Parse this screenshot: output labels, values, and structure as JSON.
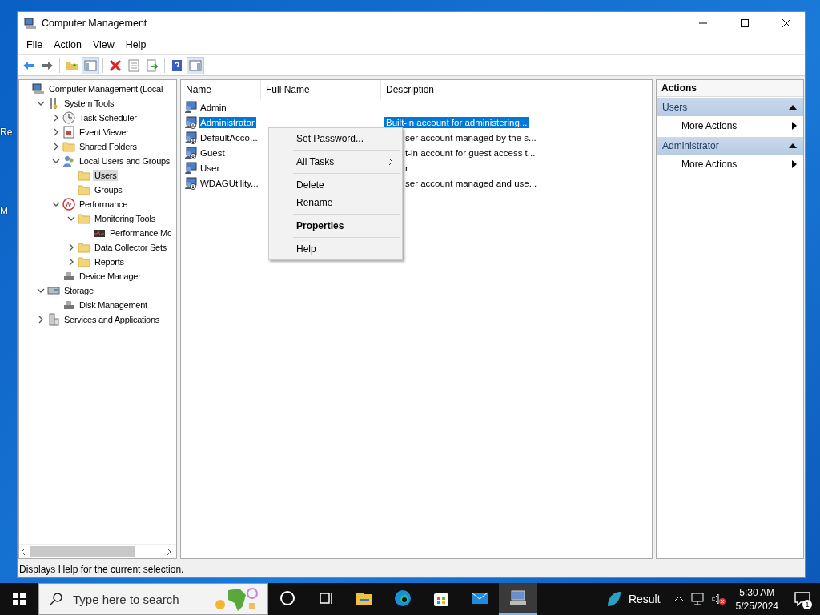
{
  "desktop": {
    "icon_labels": [
      "Re",
      "M"
    ]
  },
  "window": {
    "title": "Computer Management"
  },
  "menu": [
    "File",
    "Action",
    "View",
    "Help"
  ],
  "toolbar": [
    {
      "kind": "back",
      "pressed": false
    },
    {
      "kind": "forward",
      "pressed": false
    },
    {
      "kind": "sep"
    },
    {
      "kind": "up",
      "pressed": false
    },
    {
      "kind": "tree",
      "pressed": true
    },
    {
      "kind": "sep"
    },
    {
      "kind": "delete",
      "pressed": false
    },
    {
      "kind": "properties",
      "pressed": false
    },
    {
      "kind": "export",
      "pressed": false
    },
    {
      "kind": "sep"
    },
    {
      "kind": "help",
      "pressed": false
    },
    {
      "kind": "pane",
      "pressed": true
    }
  ],
  "tree": [
    {
      "label": "Computer Management (Local",
      "kind": "computer",
      "selected": false,
      "children": [
        {
          "label": "System Tools",
          "kind": "tools",
          "expanded": true,
          "selected": false,
          "children": [
            {
              "label": "Task Scheduler",
              "kind": "clock",
              "expanded": false,
              "selected": false
            },
            {
              "label": "Event Viewer",
              "kind": "log",
              "expanded": false,
              "selected": false
            },
            {
              "label": "Shared Folders",
              "kind": "folder",
              "expanded": false,
              "selected": false
            },
            {
              "label": "Local Users and Groups",
              "kind": "users",
              "expanded": true,
              "selected": false,
              "children": [
                {
                  "label": "Users",
                  "kind": "folder",
                  "selected": true
                },
                {
                  "label": "Groups",
                  "kind": "folder",
                  "selected": false
                }
              ]
            },
            {
              "label": "Performance",
              "kind": "perf",
              "expanded": true,
              "selected": false,
              "children": [
                {
                  "label": "Monitoring Tools",
                  "kind": "folder",
                  "expanded": true,
                  "selected": false,
                  "children": [
                    {
                      "label": "Performance Mc",
                      "kind": "monitor",
                      "selected": false
                    }
                  ]
                },
                {
                  "label": "Data Collector Sets",
                  "kind": "folder",
                  "expanded": false,
                  "selected": false
                },
                {
                  "label": "Reports",
                  "kind": "folder",
                  "expanded": false,
                  "selected": false
                }
              ]
            },
            {
              "label": "Device Manager",
              "kind": "device",
              "selected": false
            }
          ]
        },
        {
          "label": "Storage",
          "kind": "disk",
          "expanded": true,
          "selected": false,
          "children": [
            {
              "label": "Disk Management",
              "kind": "device",
              "selected": false
            }
          ]
        },
        {
          "label": "Services and Applications",
          "kind": "services",
          "expanded": false,
          "selected": false
        }
      ]
    }
  ],
  "list": {
    "columns": [
      "Name",
      "Full Name",
      "Description"
    ],
    "rows": [
      {
        "name": "Admin",
        "selected": false,
        "disabled": false
      },
      {
        "name": "Administrator",
        "description": "Built-in account for administering...",
        "clipped": false,
        "selected": true,
        "disabled": true
      },
      {
        "name": "DefaultAcco...",
        "description": "ser account managed by the s...",
        "clipped": true,
        "selected": false,
        "disabled": true
      },
      {
        "name": "Guest",
        "description": "t-in account for guest access t...",
        "clipped": true,
        "selected": false,
        "disabled": true
      },
      {
        "name": "User",
        "description": "r",
        "clipped": true,
        "selected": false,
        "disabled": false
      },
      {
        "name": "WDAGUtility...",
        "description": "ser account managed and use...",
        "clipped": true,
        "selected": false,
        "disabled": true
      }
    ]
  },
  "context_menu": [
    {
      "label": "Set Password...",
      "bold": false
    },
    {
      "kind": "sep"
    },
    {
      "label": "All Tasks",
      "bold": false,
      "submenu": true
    },
    {
      "kind": "sep"
    },
    {
      "label": "Delete",
      "bold": false
    },
    {
      "label": "Rename",
      "bold": false
    },
    {
      "kind": "sep"
    },
    {
      "label": "Properties",
      "bold": true
    },
    {
      "kind": "sep"
    },
    {
      "label": "Help",
      "bold": false
    }
  ],
  "actions": {
    "title": "Actions",
    "sections": [
      {
        "title": "Users",
        "expanded": true,
        "items": [
          "More Actions"
        ]
      },
      {
        "title": "Administrator",
        "expanded": true,
        "items": [
          "More Actions"
        ]
      }
    ]
  },
  "status_bar": "Displays Help for the current selection.",
  "taskbar": {
    "search": {
      "placeholder": "Type here to search"
    },
    "apps": [
      {
        "kind": "cortana",
        "active": false
      },
      {
        "kind": "taskview",
        "active": false
      },
      {
        "kind": "explorer",
        "active": false
      },
      {
        "kind": "edge",
        "active": false
      },
      {
        "kind": "store",
        "active": false
      },
      {
        "kind": "mail",
        "active": false
      },
      {
        "kind": "compmgmt",
        "active": true
      }
    ],
    "weather": "Result",
    "time": "5:30 AM",
    "date": "5/25/2024",
    "notifications": "1"
  }
}
